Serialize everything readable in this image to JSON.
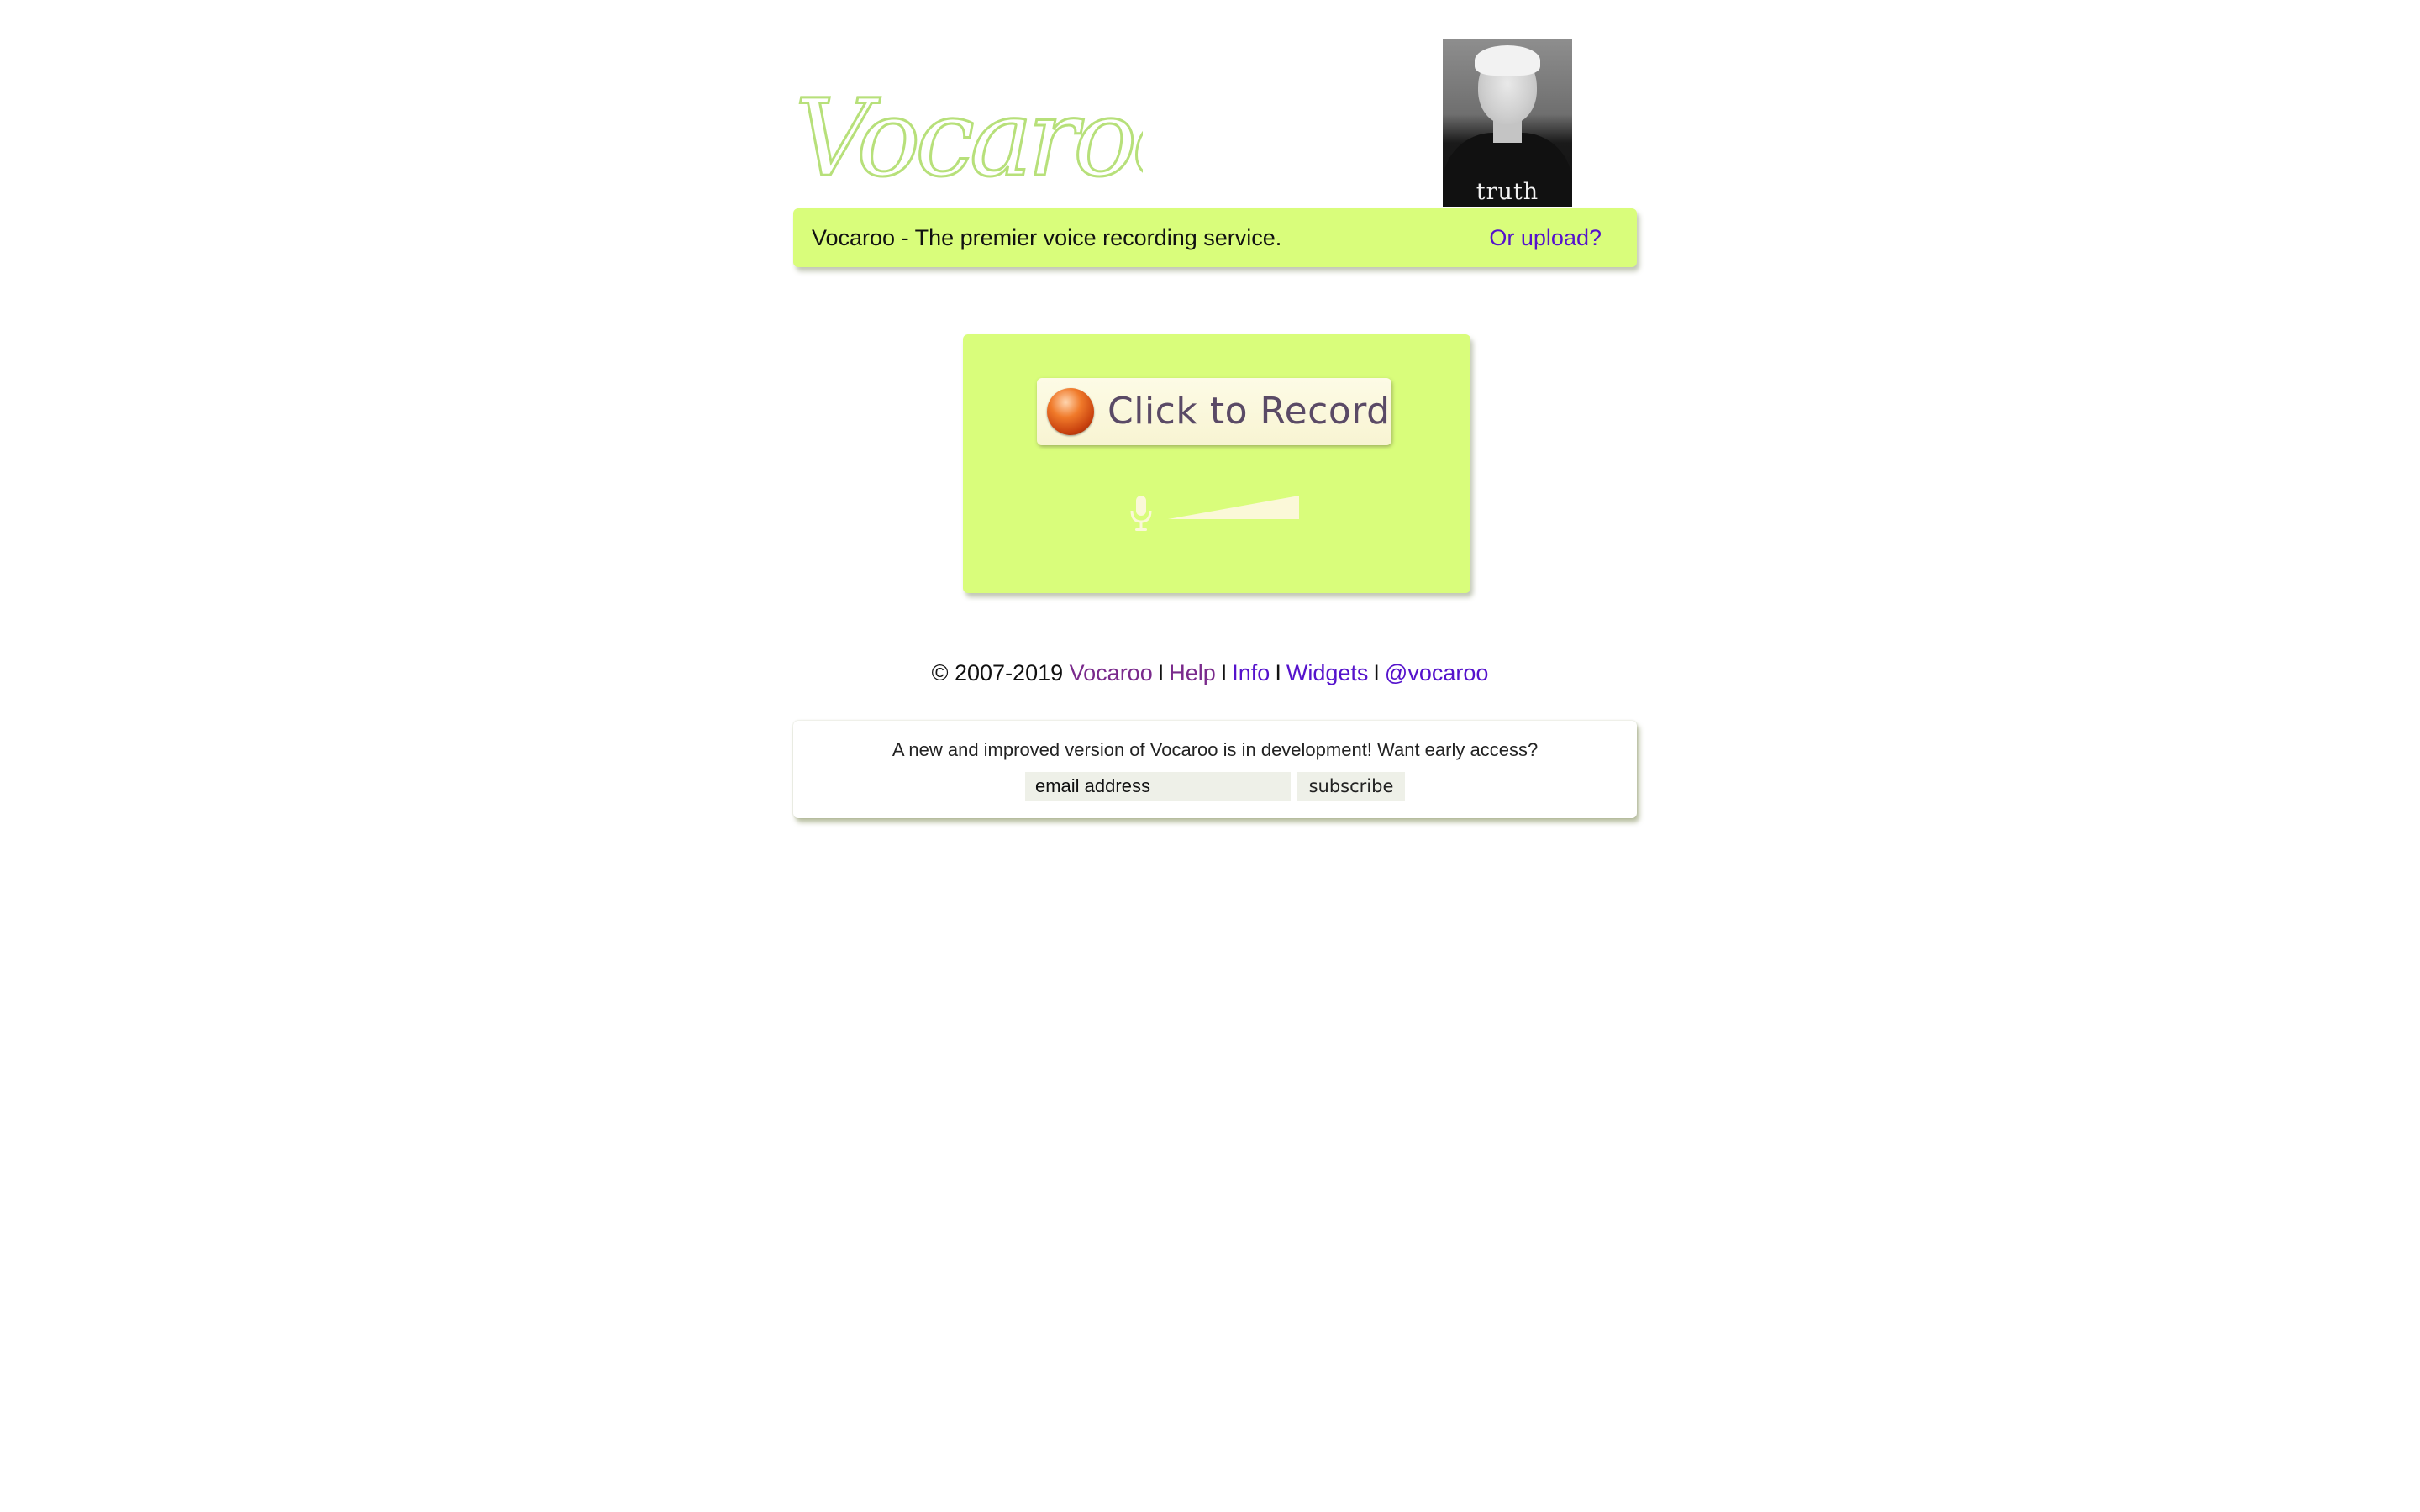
{
  "header": {
    "logo_text": "Vocaroo",
    "photo_caption": "truth",
    "tagline": "Vocaroo - The premier voice recording service.",
    "upload_link": "Or upload?",
    "accent_color": "#d9fd7b",
    "link_color": "#5512cc"
  },
  "recorder": {
    "record_label": "Click to Record",
    "record_icon": "record-dot-icon",
    "mic_icon": "microphone-icon",
    "level_meter_value": 0
  },
  "footer": {
    "copyright": "© 2007-2019",
    "links": [
      "Vocaroo",
      "Help",
      "Info",
      "Widgets",
      "@vocaroo"
    ],
    "separator": "I"
  },
  "newsletter": {
    "message": "A new and improved version of Vocaroo is in development! Want early access?",
    "email_placeholder": "email address",
    "subscribe_label": "subscribe"
  }
}
